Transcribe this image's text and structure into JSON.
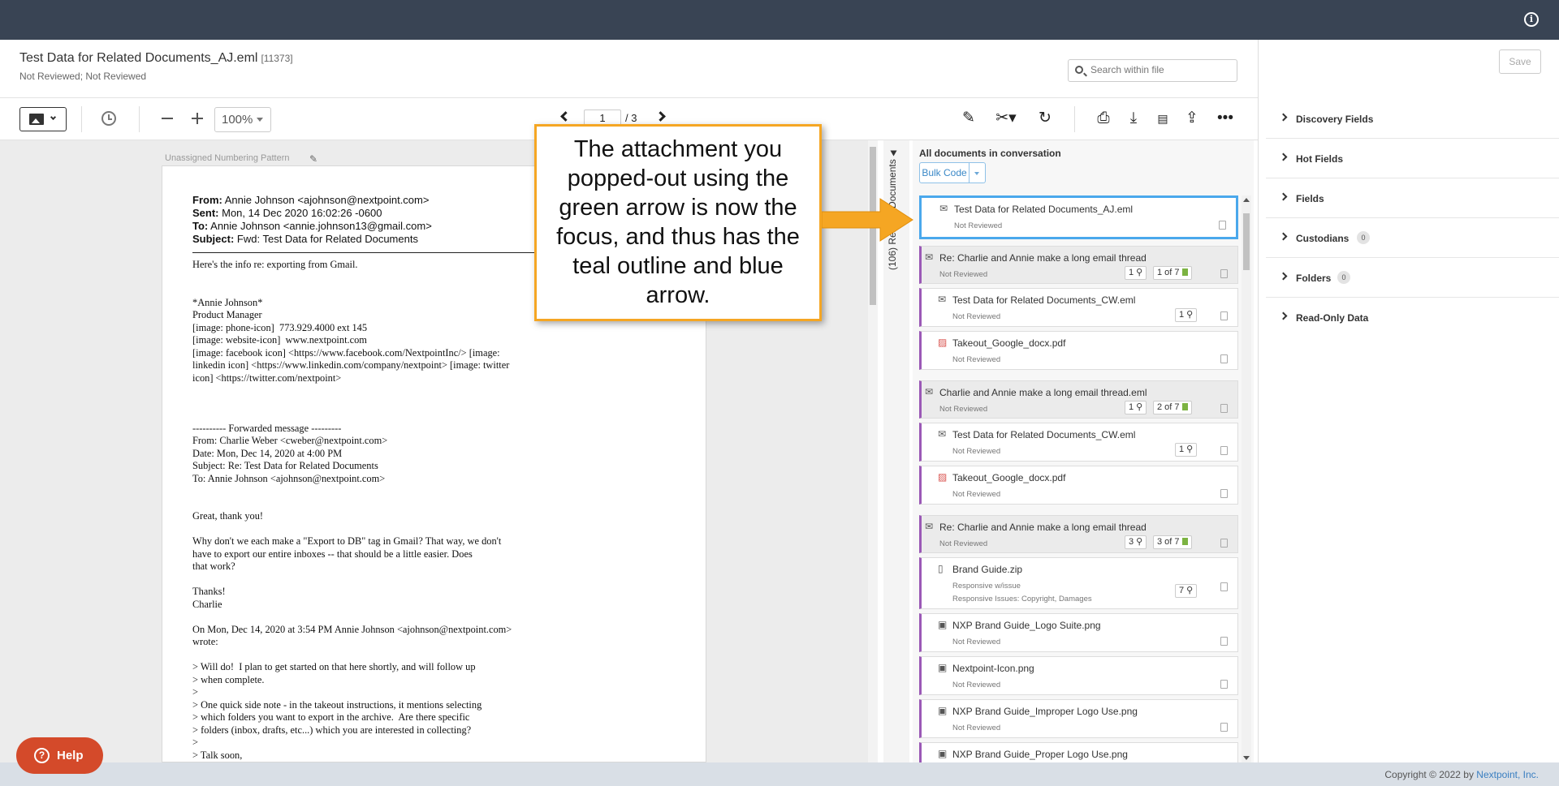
{
  "header": {
    "title": "Test Data for Related Documents_AJ.eml",
    "doc_id": "[11373]",
    "status": "Not Reviewed; Not Reviewed",
    "search_placeholder": "Search within file",
    "save_label": "Save"
  },
  "toolbar": {
    "zoom": "100%",
    "page_current": "1",
    "page_total": "/ 3"
  },
  "viewer": {
    "numbering_label": "Unassigned Numbering Pattern",
    "email": {
      "from_label": "From:",
      "from": "Annie Johnson <ajohnson@nextpoint.com>",
      "sent_label": "Sent:",
      "sent": "Mon, 14 Dec 2020 16:02:26 -0600",
      "to_label": "To:",
      "to": "Annie Johnson <annie.johnson13@gmail.com>",
      "subject_label": "Subject:",
      "subject": "Fwd: Test Data for Related Documents"
    },
    "body_lines": [
      "Here's the info re: exporting from Gmail.",
      "",
      "",
      "*Annie Johnson*",
      "Product Manager",
      "[image: phone-icon]  773.929.4000 ext 145",
      "[image: website-icon]  www.nextpoint.com",
      "[image: facebook icon] <https://www.facebook.com/NextpointInc/> [image:",
      "linkedin icon] <https://www.linkedin.com/company/nextpoint> [image: twitter",
      "icon] <https://twitter.com/nextpoint>",
      "",
      "",
      "",
      "---------- Forwarded message ---------",
      "From: Charlie Weber <cweber@nextpoint.com>",
      "Date: Mon, Dec 14, 2020 at 4:00 PM",
      "Subject: Re: Test Data for Related Documents",
      "To: Annie Johnson <ajohnson@nextpoint.com>",
      "",
      "",
      "Great, thank you!",
      "",
      "Why don't we each make a \"Export to DB\" tag in Gmail? That way, we don't",
      "have to export our entire inboxes -- that should be a little easier. Does",
      "that work?",
      "",
      "Thanks!",
      "Charlie",
      "",
      "On Mon, Dec 14, 2020 at 3:54 PM Annie Johnson <ajohnson@nextpoint.com>",
      "wrote:",
      "",
      "> Will do!  I plan to get started on that here shortly, and will follow up",
      "> when complete.",
      ">",
      "> One quick side note - in the takeout instructions, it mentions selecting",
      "> which folders you want to export in the archive.  Are there specific",
      "> folders (inbox, drafts, etc...) which you are interested in collecting?",
      ">",
      "> Talk soon,"
    ]
  },
  "related": {
    "tab_label": "(106) Related Documents",
    "panel_title": "All documents in conversation",
    "bulk_code_label": "Bulk Code",
    "items": [
      {
        "name": "Test Data for Related Documents_AJ.eml",
        "status": "Not Reviewed",
        "icon": "email-icon"
      },
      {
        "name": "Re: Charlie and Annie make a long email thread",
        "status": "Not Reviewed",
        "attachments": "1",
        "position": "1 of 7",
        "icon": "email-thread-icon"
      },
      {
        "name": "Test Data for Related Documents_CW.eml",
        "status": "Not Reviewed",
        "attachments": "1",
        "icon": "email-thread-icon"
      },
      {
        "name": "Takeout_Google_docx.pdf",
        "status": "Not Reviewed",
        "icon": "pdf-icon"
      },
      {
        "name": "Charlie and Annie make a long email thread.eml",
        "status": "Not Reviewed",
        "attachments": "1",
        "position": "2 of 7",
        "icon": "email-thread-icon"
      },
      {
        "name": "Test Data for Related Documents_CW.eml",
        "status": "Not Reviewed",
        "attachments": "1",
        "icon": "email-thread-icon"
      },
      {
        "name": "Takeout_Google_docx.pdf",
        "status": "Not Reviewed",
        "icon": "pdf-icon"
      },
      {
        "name": "Re: Charlie and Annie make a long email thread",
        "status": "Not Reviewed",
        "attachments": "3",
        "position": "3 of 7",
        "icon": "email-thread-icon"
      },
      {
        "name": "Brand Guide.zip",
        "status": "Responsive w/issue",
        "status2": "Responsive Issues: Copyright, Damages",
        "attachments": "7",
        "icon": "zip-icon"
      },
      {
        "name": "NXP Brand Guide_Logo Suite.png",
        "status": "Not Reviewed",
        "icon": "image-icon"
      },
      {
        "name": "Nextpoint-Icon.png",
        "status": "Not Reviewed",
        "icon": "image-icon"
      },
      {
        "name": "NXP Brand Guide_Improper Logo Use.png",
        "status": "Not Reviewed",
        "icon": "image-icon"
      },
      {
        "name": "NXP Brand Guide_Proper Logo Use.png",
        "status": "",
        "icon": "image-icon"
      }
    ]
  },
  "fields_panel": {
    "sections": [
      {
        "label": "Discovery Fields"
      },
      {
        "label": "Hot Fields"
      },
      {
        "label": "Fields"
      },
      {
        "label": "Custodians",
        "count": "0"
      },
      {
        "label": "Folders",
        "count": "0"
      },
      {
        "label": "Read-Only Data"
      }
    ]
  },
  "callout": {
    "text": "The attachment you popped-out using the green arrow is now the focus, and thus has the teal outline and blue arrow."
  },
  "footer": {
    "copyright_prefix": "Copyright © 2022 by ",
    "company": "Nextpoint, Inc."
  },
  "help": {
    "label": "Help"
  },
  "colors": {
    "topbar": "#394454",
    "focus_outline": "#4aa8ec",
    "thread_bar": "#9b59b6",
    "callout_border": "#f5a623",
    "help_button": "#d44a2a"
  }
}
